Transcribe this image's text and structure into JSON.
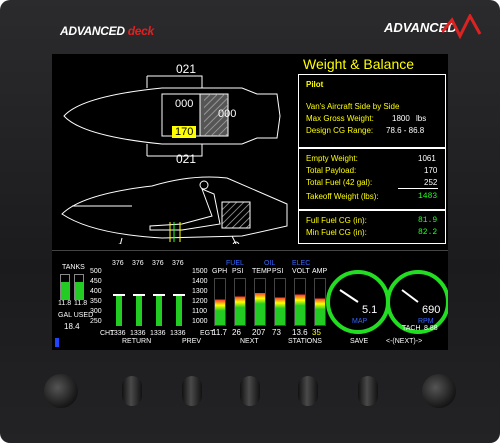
{
  "brand": {
    "left_logo_main": "ADVANCED",
    "left_logo_accent": "deck",
    "right_logo": "ADVANCED"
  },
  "top_view": {
    "heading_top": "021",
    "heading_bottom": "021",
    "left_seat": "000",
    "right_seat": "000",
    "pilot_weight": "170"
  },
  "panel": {
    "title": "Weight & Balance",
    "pilot_label": "Pilot",
    "aircraft": "Van's Aircraft Side by Side",
    "max_gross_label": "Max Gross Weight:",
    "max_gross_value": "1800",
    "max_gross_unit": "lbs",
    "cg_range_label": "Design CG Range:",
    "cg_range_value": "78.6 - 86.8",
    "empty_label": "Empty Weight:",
    "empty_value": "1061",
    "payload_label": "Total Payload:",
    "payload_value": "170",
    "fuel_label": "Total Fuel (42 gal):",
    "fuel_value": "252",
    "takeoff_label": "Takeoff Weight (lbs):",
    "takeoff_value": "1483",
    "full_cg_label": "Full Fuel CG (in):",
    "full_cg_value": "81.9",
    "min_cg_label": "Min Fuel CG (in):",
    "min_cg_value": "82.2"
  },
  "engine": {
    "tanks_label": "TANKS",
    "tank_left": "11.8",
    "tank_right": "11.8",
    "gal_used_label": "GAL USED",
    "gal_used_value": "18.4",
    "cht_top": [
      "376",
      "376",
      "376",
      "376"
    ],
    "egt_scale": [
      "1500",
      "1400",
      "1300",
      "1200",
      "1100",
      "1000"
    ],
    "cht_scale": [
      "500",
      "450",
      "400",
      "350",
      "300",
      "250"
    ],
    "cht_bottom": [
      "1336",
      "1336",
      "1336",
      "1336"
    ],
    "cht_label": "CHT",
    "egt_label": "EGT",
    "fuel_header": "FUEL",
    "oil_header": "OIL",
    "elec_header": "ELEC",
    "gauges": [
      {
        "label": "GPH",
        "value": "11.7",
        "level": 0.55
      },
      {
        "label": "PSI",
        "value": "26",
        "level": 0.62
      },
      {
        "label": "TEMP",
        "value": "207",
        "level": 0.7
      },
      {
        "label": "PSI",
        "value": "73",
        "level": 0.6
      },
      {
        "label": "VOLT",
        "value": "13.6",
        "level": 0.66
      },
      {
        "label": "AMP",
        "value": "35",
        "level": 0.58
      }
    ],
    "map_value": "5.1",
    "map_unit": "MAP",
    "rpm_value": "690",
    "rpm_unit": "RPM",
    "tach_label": "TACH",
    "tach_value": "8.88"
  },
  "softkeys": [
    "RETURN",
    "PREV",
    "NEXT",
    "STATIONS",
    "SAVE",
    "<-(NEXT)->"
  ]
}
